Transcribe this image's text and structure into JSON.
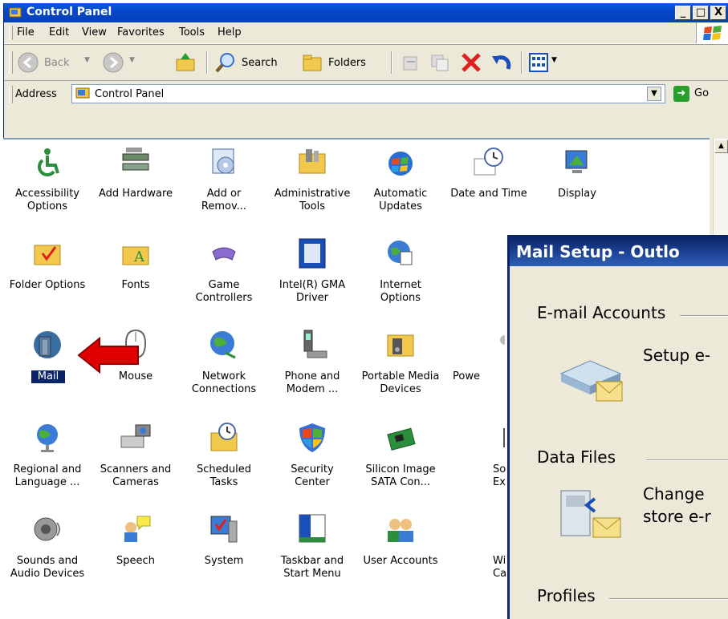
{
  "window": {
    "title": "Control Panel",
    "min_label": "_",
    "max_label": "□",
    "close_label": "X"
  },
  "menu": [
    "File",
    "Edit",
    "View",
    "Favorites",
    "Tools",
    "Help"
  ],
  "toolbar": {
    "back_label": "Back",
    "search_label": "Search",
    "folders_label": "Folders"
  },
  "address": {
    "label": "Address",
    "value": "Control Panel",
    "go_label": "Go"
  },
  "items": [
    {
      "label": "Accessibility\nOptions",
      "icon": "accessibility-icon"
    },
    {
      "label": "Add Hardware",
      "icon": "add-hardware-icon"
    },
    {
      "label": "Add or\nRemov...",
      "icon": "add-remove-programs-icon"
    },
    {
      "label": "Administrative\nTools",
      "icon": "administrative-tools-icon"
    },
    {
      "label": "Automatic\nUpdates",
      "icon": "automatic-updates-icon"
    },
    {
      "label": "Date and Time",
      "icon": "date-time-icon"
    },
    {
      "label": "Display",
      "icon": "display-icon"
    },
    {
      "label": "Folder Options",
      "icon": "folder-options-icon"
    },
    {
      "label": "Fonts",
      "icon": "fonts-icon"
    },
    {
      "label": "Game\nControllers",
      "icon": "game-controllers-icon"
    },
    {
      "label": "Intel(R) GMA\nDriver",
      "icon": "intel-gma-icon"
    },
    {
      "label": "Internet\nOptions",
      "icon": "internet-options-icon"
    },
    {
      "label": "Mail",
      "icon": "mail-icon"
    },
    {
      "label": "Mouse",
      "icon": "mouse-icon"
    },
    {
      "label": "Network\nConnections",
      "icon": "network-connections-icon"
    },
    {
      "label": "Phone and\nModem ...",
      "icon": "phone-modem-icon"
    },
    {
      "label": "Portable Media\nDevices",
      "icon": "portable-media-icon"
    },
    {
      "label": "Powe",
      "icon": "power-options-icon"
    },
    {
      "label": "Regional and\nLanguage ...",
      "icon": "regional-icon"
    },
    {
      "label": "Scanners and\nCameras",
      "icon": "scanners-icon"
    },
    {
      "label": "Scheduled\nTasks",
      "icon": "scheduled-tasks-icon"
    },
    {
      "label": "Security\nCenter",
      "icon": "security-center-icon"
    },
    {
      "label": "Silicon Image\nSATA Con...",
      "icon": "silicon-image-icon"
    },
    {
      "label": "So\nEx",
      "icon": "sound-effects-icon"
    },
    {
      "label": "Sounds and\nAudio Devices",
      "icon": "sounds-icon"
    },
    {
      "label": "Speech",
      "icon": "speech-icon"
    },
    {
      "label": "System",
      "icon": "system-icon"
    },
    {
      "label": "Taskbar and\nStart Menu",
      "icon": "taskbar-icon"
    },
    {
      "label": "User Accounts",
      "icon": "user-accounts-icon"
    },
    {
      "label": "Wi\nCar",
      "icon": "wireless-icon"
    }
  ],
  "dialog": {
    "title": "Mail Setup - Outlo",
    "email_section": "E-mail Accounts",
    "email_text": "Setup e-",
    "data_section": "Data Files",
    "data_text_1": "Change",
    "data_text_2": "store e-r",
    "profiles_section": "Profiles"
  },
  "colors": {
    "titlebar": "#0a5ae0",
    "selection": "#0a246a",
    "arrow": "#e00000",
    "dialog_title": "#0a246a"
  }
}
